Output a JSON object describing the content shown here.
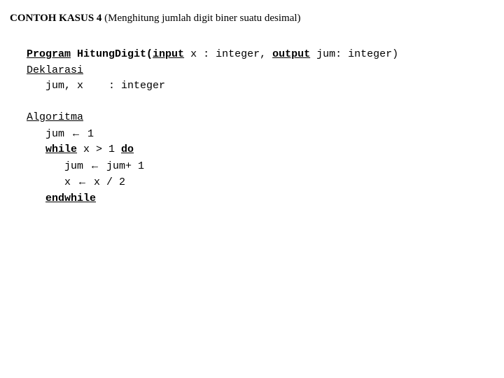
{
  "title": {
    "heading": "CONTOH KASUS 4",
    "sub": " (Menghitung jumlah digit biner suatu desimal)"
  },
  "code": {
    "kw_program": "Program",
    "progname": " HitungDigit(",
    "kw_input": "input",
    "sig_mid": " x : integer, ",
    "kw_output": "output",
    "sig_end": " jum: integer)",
    "kw_deklarasi": "Deklarasi",
    "decl_vars": "   jum, x    : integer",
    "kw_algoritma": "Algoritma",
    "l_jum1a": "   jum ",
    "arrow": "←",
    "l_jum1b": " 1",
    "kw_while": "while",
    "l_while_mid": " x > 1 ",
    "kw_do": "do",
    "l_jumplus_a": "      jum ",
    "l_jumplus_b": " jum+ 1",
    "l_xdiv_a": "      x ",
    "l_xdiv_b": " x / 2",
    "kw_endwhile": "endwhile"
  }
}
